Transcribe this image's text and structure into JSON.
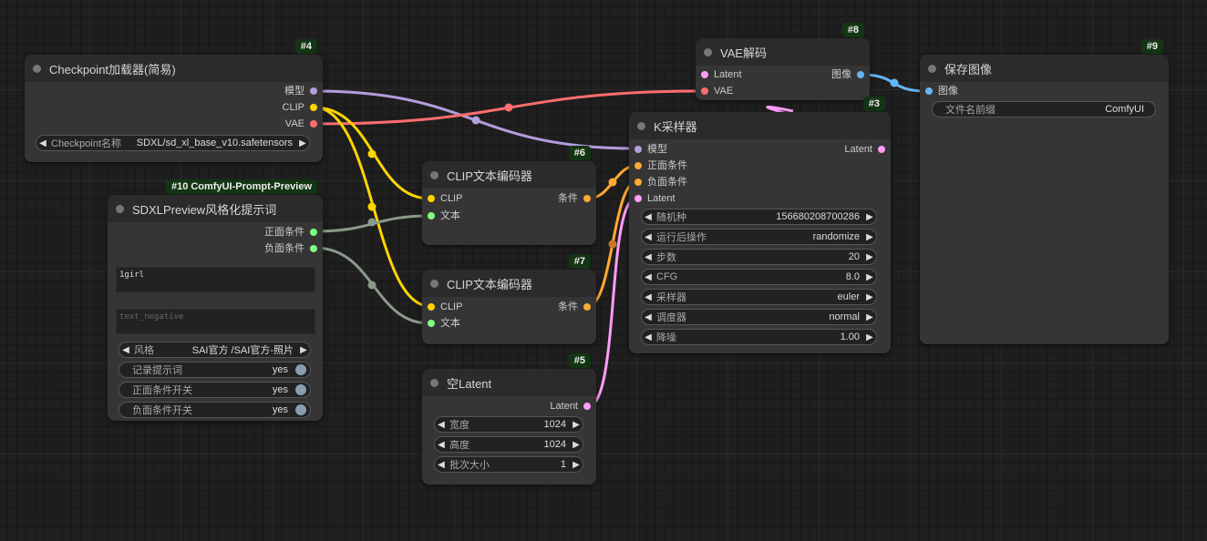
{
  "nodes": {
    "checkpoint": {
      "badge": "#4",
      "title": "Checkpoint加载器(简易)",
      "outputs": [
        "模型",
        "CLIP",
        "VAE"
      ],
      "widget": {
        "label": "Checkpoint名称",
        "value": "SDXL/sd_xl_base_v10.safetensors"
      }
    },
    "sdxlpreview": {
      "badge": "#10 ComfyUI-Prompt-Preview",
      "title": "SDXLPreview风格化提示词",
      "outputs": [
        "正面条件",
        "负面条件"
      ],
      "text_positive": "1girl",
      "text_negative_placeholder": "text_negative",
      "style": {
        "label": "风格",
        "value": "SAI官方 /SAI官方-照片"
      },
      "toggles": [
        {
          "label": "记录提示词",
          "value": "yes"
        },
        {
          "label": "正面条件开关",
          "value": "yes"
        },
        {
          "label": "负面条件开关",
          "value": "yes"
        }
      ]
    },
    "clip6": {
      "badge": "#6",
      "title": "CLIP文本编码器",
      "inputs": [
        "CLIP",
        "文本"
      ],
      "outputs": [
        "条件"
      ]
    },
    "clip7": {
      "badge": "#7",
      "title": "CLIP文本编码器",
      "inputs": [
        "CLIP",
        "文本"
      ],
      "outputs": [
        "条件"
      ]
    },
    "latent": {
      "badge": "#5",
      "title": "空Latent",
      "outputs": [
        "Latent"
      ],
      "widgets": [
        {
          "label": "宽度",
          "value": "1024"
        },
        {
          "label": "高度",
          "value": "1024"
        },
        {
          "label": "批次大小",
          "value": "1"
        }
      ]
    },
    "vae": {
      "badge": "#8",
      "title": "VAE解码",
      "inputs": [
        "Latent",
        "VAE"
      ],
      "outputs": [
        "图像"
      ]
    },
    "ksampler": {
      "badge": "#3",
      "title": "K采样器",
      "inputs": [
        "模型",
        "正面条件",
        "负面条件",
        "Latent"
      ],
      "outputs": [
        "Latent"
      ],
      "widgets": [
        {
          "label": "随机种",
          "value": "156680208700286"
        },
        {
          "label": "运行后操作",
          "value": "randomize"
        },
        {
          "label": "步数",
          "value": "20"
        },
        {
          "label": "CFG",
          "value": "8.0"
        },
        {
          "label": "采样器",
          "value": "euler"
        },
        {
          "label": "调度器",
          "value": "normal"
        },
        {
          "label": "降噪",
          "value": "1.00"
        }
      ]
    },
    "save": {
      "badge": "#9",
      "title": "保存图像",
      "inputs": [
        "图像"
      ],
      "widget": {
        "label": "文件名前缀",
        "value": "ComfyUI"
      }
    }
  },
  "colors": {
    "model": "#b39ddb",
    "clip": "#ffd500",
    "vae": "#ff6e6e",
    "conditioning": "#ffa931",
    "latent": "#ff9cf9",
    "image": "#64b5f6",
    "string": "#7fff7f",
    "cond_wire": "#8a9a8a"
  }
}
